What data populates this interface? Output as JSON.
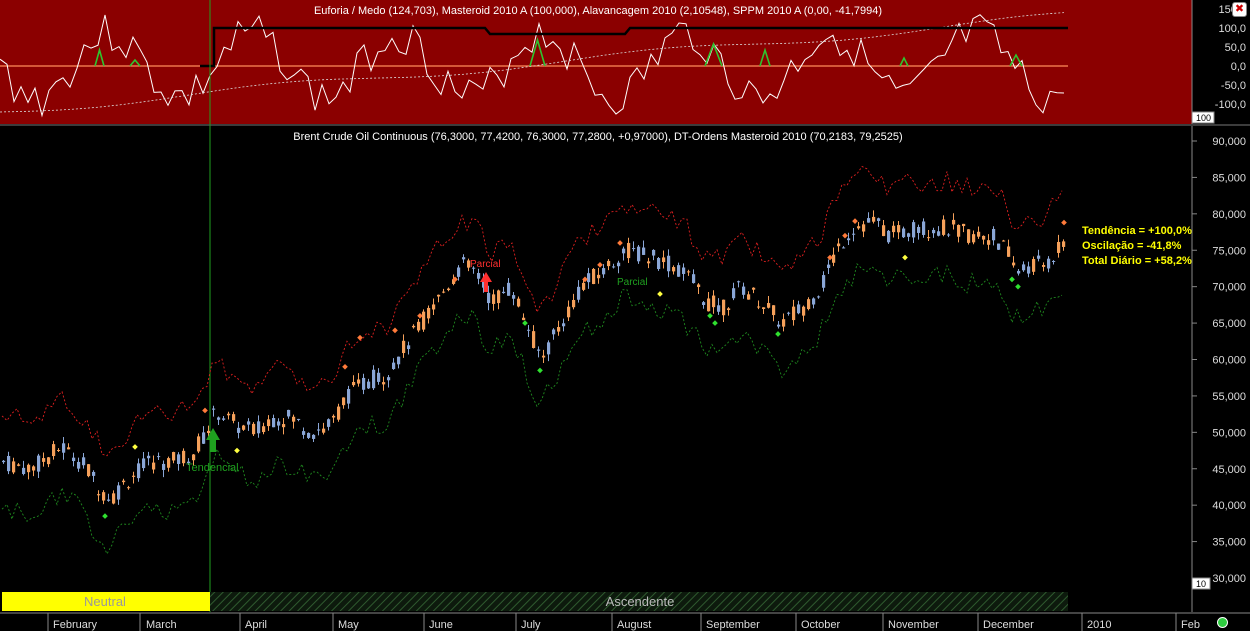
{
  "window": {
    "close_glyph": "✖"
  },
  "indicator_panel": {
    "title": "Euforia / Medo (124,703), Masteroid 2010 A (100,000), Alavancagem 2010 (2,10548), SPPM 2010 A (0,00, -41,7994)",
    "y_ticks": [
      "150,0",
      "100,0",
      "50,0",
      "0,0",
      "-50,0",
      "-100,0"
    ],
    "corner_label": "100"
  },
  "price_panel": {
    "title": "Brent Crude Oil Continuous (76,3000, 77,4200, 76,3000, 77,2800, +0,97000), DT-Ordens Masteroid 2010 (70,2183, 79,2525)",
    "y_ticks": [
      "90,000",
      "85,000",
      "80,000",
      "75,000",
      "70,000",
      "65,000",
      "60,000",
      "55,000",
      "50,000",
      "45,000",
      "40,000",
      "35,000",
      "30,000"
    ],
    "corner_label": "10",
    "stats": {
      "tendencia": "Tendência = +100,0%",
      "oscilacao": "Oscilação = -41,8%",
      "total": "Total Diário = +58,2%"
    },
    "annotations": {
      "tendencial": "Tendencial",
      "parcial_red": "Parcial",
      "parcial_green": "Parcial"
    }
  },
  "regime_bar": {
    "neutral": "Neutral",
    "ascendente": "Ascendente"
  },
  "x_axis": {
    "months": [
      "February",
      "March",
      "April",
      "May",
      "June",
      "July",
      "August",
      "September",
      "October",
      "November",
      "December",
      "2010",
      "Feb"
    ]
  },
  "colors": {
    "indicator_bg": "#8b0000",
    "up_candle": "#8aa6d6",
    "down_candle": "#f5a05a",
    "upper_band": "#e02020",
    "lower_band": "#1f8a1f",
    "neutral_bar": "#ffff00",
    "stats_text": "#ffff00"
  },
  "chart_data": {
    "type": "line",
    "x": [
      "February",
      "March",
      "April",
      "May",
      "June",
      "July",
      "August",
      "September",
      "October",
      "November",
      "December"
    ],
    "series": [
      {
        "name": "Brent Crude Oil Continuous",
        "values": [
          45,
          42,
          52,
          55,
          70,
          60,
          73,
          68,
          67,
          79,
          73
        ]
      }
    ],
    "last_value": {
      "open": 76.3,
      "high": 77.42,
      "low": 76.3,
      "close": 77.28,
      "change": 0.97
    },
    "band_last": {
      "lower": 70.2183,
      "upper": 79.2525
    },
    "ylim": [
      30,
      90
    ]
  }
}
